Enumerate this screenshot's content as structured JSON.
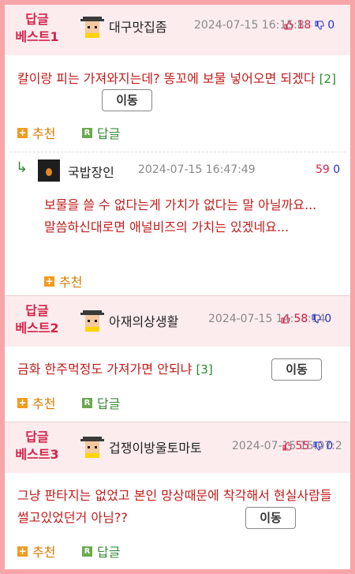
{
  "comments": [
    {
      "best_label_1": "답글",
      "best_label_2": "베스트1",
      "nick": "대구맛집좀",
      "date": "2024-07-15 16:15:8",
      "up": "18",
      "down": "0",
      "text": "칼이랑 피는 가져와지는데? 똥꼬에 보물 넣어오면 되겠다",
      "reply_count": "[2]",
      "move_label": "이동",
      "recommend_label": "추천",
      "reply_label": "답글"
    },
    {
      "nick": "국밥장인",
      "date": "2024-07-15 16:47:49",
      "up": "59",
      "down": "0",
      "text": "보물을 쓸 수 없다는게 가치가 없다는 말 아닐까요... 말씀하신대로면 애널비즈의 가치는 있겠네요...",
      "recommend_label": "추천"
    },
    {
      "best_label_1": "답글",
      "best_label_2": "베스트2",
      "nick": "아재의상생활",
      "date": "2024-07-15 14:58:14",
      "up": "58",
      "down": "0",
      "text": "금화 한주먹정도 가져가면 안되냐",
      "reply_count": "[3]",
      "move_label": "이동",
      "recommend_label": "추천",
      "reply_label": "답글"
    },
    {
      "best_label_1": "답글",
      "best_label_2": "베스트3",
      "nick": "겁쟁이방울토마토",
      "date": "2024-07-15 15:07:2",
      "up": "55",
      "down": "0",
      "text": "그냥 판타지는 없었고 본인 망상때문에 착각해서 현실사람들 썰고있었던거 아님??",
      "move_label": "이동",
      "recommend_label": "추천",
      "reply_label": "답글"
    }
  ],
  "colors": {
    "accent": "#d3234a",
    "comment_text": "#c21b1b",
    "frame": "#f7a5a8",
    "header_bg": "#fdecee"
  },
  "icons": [
    "pixel-avatar-icon",
    "thumb-up-icon",
    "thumb-down-icon",
    "plus-icon",
    "reply-r-icon",
    "reply-arrow-icon"
  ]
}
